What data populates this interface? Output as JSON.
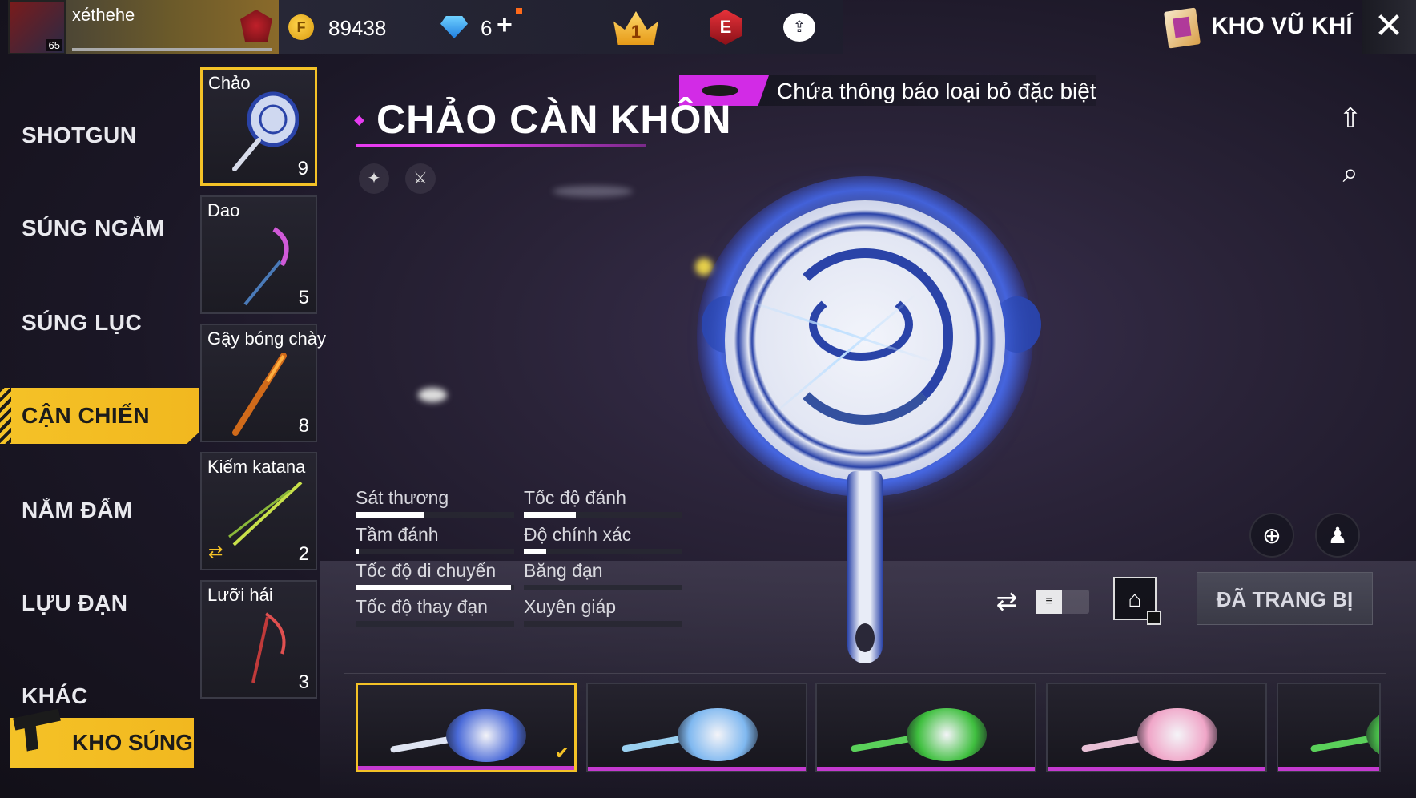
{
  "topbar": {
    "username": "xéthehe",
    "level": "65",
    "gold": "89438",
    "gold_symbol": "F",
    "diamonds": "6",
    "diamond_plus": "+",
    "crown_number": "1",
    "elite_letter": "E",
    "armory_title": "KHO VŨ KHÍ",
    "close_symbol": "✕"
  },
  "sidebar": {
    "items": [
      {
        "label": "SHOTGUN"
      },
      {
        "label": "SÚNG NGẮM"
      },
      {
        "label": "SÚNG LỤC"
      },
      {
        "label": "CẬN CHIẾN"
      },
      {
        "label": "NẮM ĐẤM"
      },
      {
        "label": "LỰU ĐẠN"
      },
      {
        "label": "KHÁC"
      }
    ],
    "active_item": "CẬN CHIẾN",
    "kho_sung_label": "KHO SÚNG"
  },
  "categories": [
    {
      "label": "Chảo",
      "count": "9"
    },
    {
      "label": "Dao",
      "count": "5"
    },
    {
      "label": "Gậy bóng chày",
      "count": "8"
    },
    {
      "label": "Kiếm katana",
      "count": "2"
    },
    {
      "label": "Lưỡi hái",
      "count": "3"
    }
  ],
  "detail": {
    "notice": "Chứa thông báo loại bỏ đặc biệt",
    "title": "CHẢO CÀN KHÔN",
    "stats": [
      {
        "label": "Sát thương",
        "value": 0.43
      },
      {
        "label": "Tốc độ đánh",
        "value": 0.33
      },
      {
        "label": "Tầm đánh",
        "value": 0.02
      },
      {
        "label": "Độ chính xác",
        "value": 0.14
      },
      {
        "label": "Tốc độ di chuyển",
        "value": 0.98
      },
      {
        "label": "Băng đạn",
        "value": 0.0
      },
      {
        "label": "Tốc độ thay đạn",
        "value": 0.0
      },
      {
        "label": "Xuyên giáp",
        "value": 0.0
      }
    ],
    "equipped_label": "ĐÃ TRANG BỊ",
    "toggle_symbol": "≡"
  },
  "colors": {
    "accent_yellow": "#f4c227",
    "accent_magenta": "#e63bf0",
    "pan_blue": "#2a43a8"
  },
  "icons": {
    "share": "share-icon",
    "search_doc": "document-search-icon",
    "zoom": "zoom-in-icon",
    "pose": "character-pose-icon",
    "shuffle": "shuffle-icon",
    "home": "home-star-icon"
  },
  "skins": [
    {
      "name": "blue-dragon-pan",
      "color": "#4a6ad8"
    },
    {
      "name": "ice-crystal-pan",
      "color": "#7fb8f0"
    },
    {
      "name": "green-gold-pan",
      "color": "#3fbf3f"
    },
    {
      "name": "pink-hand-pan",
      "color": "#f0a6c8"
    },
    {
      "name": "green-pan",
      "color": "#49c04a"
    }
  ]
}
